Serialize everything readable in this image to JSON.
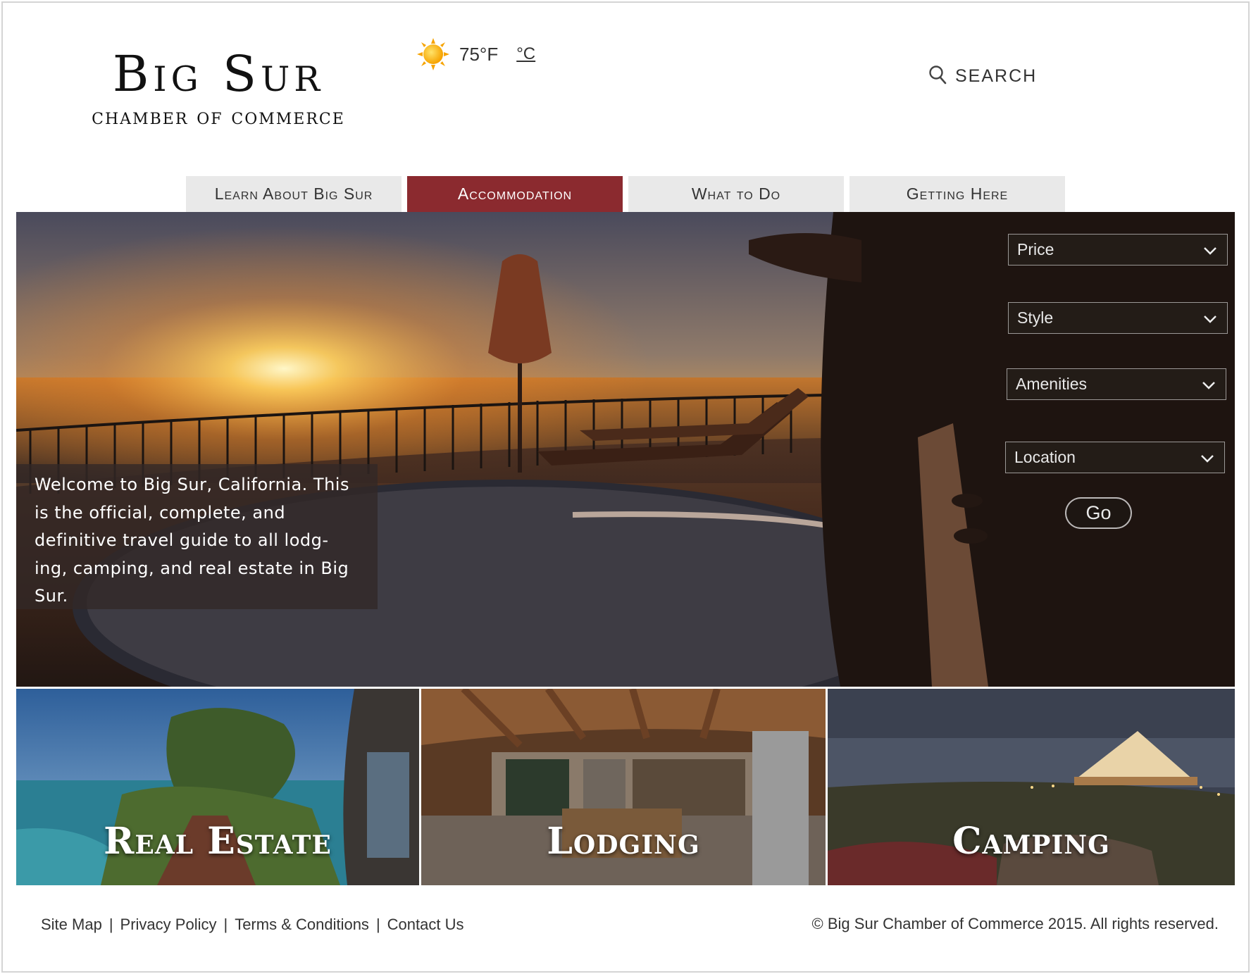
{
  "logo": {
    "line1": "Big Sur",
    "line2": "Chamber of Commerce"
  },
  "weather": {
    "icon": "sun-icon",
    "temperature": "75°F",
    "alt_unit": "°C"
  },
  "search": {
    "icon": "search-icon",
    "label": "SEARCH"
  },
  "nav": {
    "tabs": [
      {
        "label": "Learn About Big Sur",
        "active": false
      },
      {
        "label": "Accommodation",
        "active": true
      },
      {
        "label": "What to Do",
        "active": false
      },
      {
        "label": "Getting Here",
        "active": false
      }
    ]
  },
  "hero": {
    "welcome_text": "Welcome to Big Sur, California. This is the official, complete, and definitive travel guide to all lodg-ing, camping, and real estate in Big Sur.",
    "filters": {
      "price": "Price",
      "style": "Style",
      "amenities": "Amenities",
      "location": "Location"
    },
    "go_label": "Go"
  },
  "categories": [
    {
      "label": "Real Estate"
    },
    {
      "label": "Lodging"
    },
    {
      "label": "Camping"
    }
  ],
  "footer": {
    "links": [
      "Site Map",
      "Privacy Policy",
      "Terms & Conditions",
      "Contact Us"
    ],
    "separator": "|",
    "copyright": "© Big Sur Chamber of Commerce 2015. All rights reserved."
  },
  "colors": {
    "accent": "#8b2a2f",
    "tab_bg": "#e9e9e9"
  }
}
